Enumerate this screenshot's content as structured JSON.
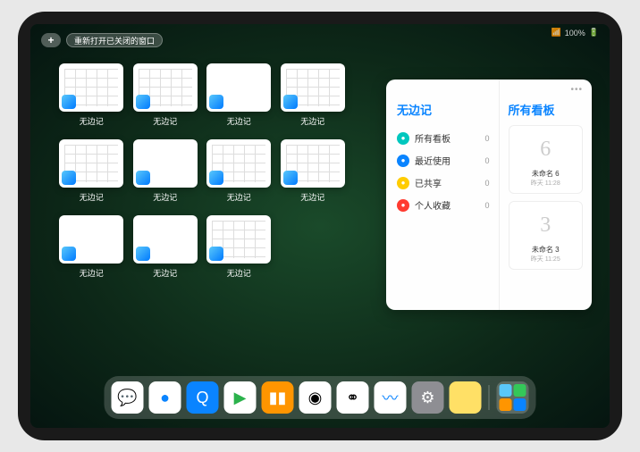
{
  "status": {
    "battery": "100%"
  },
  "buttons": {
    "plus": "+",
    "reopen": "重新打开已关闭的窗口"
  },
  "app_label": "无边记",
  "grid_count": 11,
  "grid_calendar_indices": [
    1,
    2,
    4,
    5,
    7,
    8,
    11
  ],
  "panel": {
    "dots": "•••",
    "left_title": "无边记",
    "right_title": "所有看板",
    "items": [
      {
        "icon_bg": "#00c7be",
        "label": "所有看板",
        "count": "0"
      },
      {
        "icon_bg": "#0a84ff",
        "label": "最近使用",
        "count": "0"
      },
      {
        "icon_bg": "#ffcc00",
        "label": "已共享",
        "count": "0"
      },
      {
        "icon_bg": "#ff3b30",
        "label": "个人收藏",
        "count": "0"
      }
    ],
    "boards": [
      {
        "sketch": "6",
        "title": "未命名 6",
        "sub": "昨天 11:28"
      },
      {
        "sketch": "3",
        "title": "未命名 3",
        "sub": "昨天 11:25"
      }
    ]
  },
  "dock": [
    {
      "name": "wechat",
      "bg": "#fff",
      "glyph": "💬"
    },
    {
      "name": "browser1",
      "bg": "#fff",
      "glyph": "●",
      "color": "#0a84ff"
    },
    {
      "name": "browser2",
      "bg": "#0a84ff",
      "glyph": "Q",
      "color": "#fff"
    },
    {
      "name": "media",
      "bg": "#fff",
      "glyph": "▶",
      "color": "#2bb24c"
    },
    {
      "name": "books",
      "bg": "#ff9500",
      "glyph": "▮▮",
      "color": "#fff"
    },
    {
      "name": "dice",
      "bg": "#fff",
      "glyph": "◉",
      "color": "#000"
    },
    {
      "name": "share",
      "bg": "#fff",
      "glyph": "⚭",
      "color": "#000"
    },
    {
      "name": "freeform",
      "bg": "#fff",
      "glyph": "〰",
      "color": "#0a84ff"
    },
    {
      "name": "settings",
      "bg": "#8e8e93",
      "glyph": "⚙",
      "color": "#fff"
    },
    {
      "name": "notes",
      "bg": "#ffe066",
      "glyph": "",
      "color": "#fff"
    }
  ]
}
